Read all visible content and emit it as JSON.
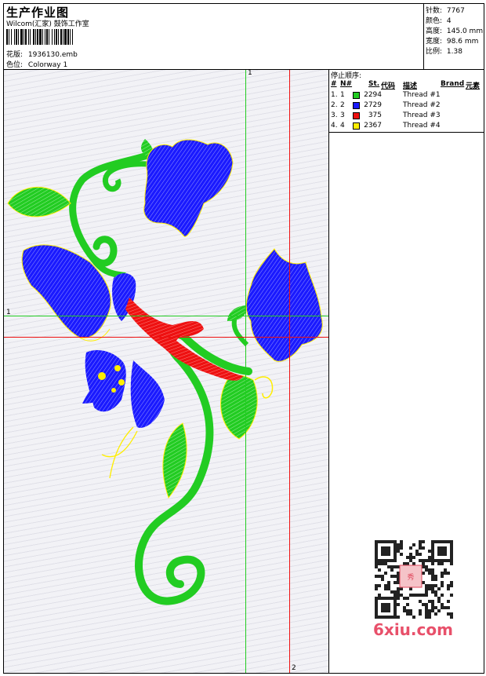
{
  "header": {
    "title": "生产作业图",
    "company": "Wilcom(汇家) 鼓饰工作室",
    "design_label": "花版:",
    "design_value": "1936130.emb",
    "colorway_label": "色位:",
    "colorway_value": "Colorway 1"
  },
  "stats": {
    "stitches_label": "针数:",
    "stitches_value": "7767",
    "colors_label": "颜色:",
    "colors_value": "4",
    "height_label": "高度:",
    "height_value": "145.0 mm",
    "width_label": "宽度:",
    "width_value": "98.6 mm",
    "scale_label": "比例:",
    "scale_value": "1.38"
  },
  "stop_sequence": {
    "title": "停止顺序:",
    "columns": [
      "#",
      "N#",
      "St.",
      "代码",
      "描述",
      "Brand",
      "元素"
    ],
    "rows": [
      {
        "num": "1.",
        "n": "1",
        "code": "2294",
        "desc": "Thread #1",
        "color": "#22cc22"
      },
      {
        "num": "2.",
        "n": "2",
        "code": "2729",
        "desc": "Thread #2",
        "color": "#1a1aff"
      },
      {
        "num": "3.",
        "n": "3",
        "code": "375",
        "desc": "Thread #3",
        "color": "#ee1111"
      },
      {
        "num": "4.",
        "n": "4",
        "code": "2367",
        "desc": "Thread #4",
        "color": "#ffee00"
      }
    ]
  },
  "canvas": {
    "marker_1_top": "1",
    "marker_1_left": "1",
    "marker_2_bottom": "2"
  },
  "watermark": {
    "site": "6xiu.com"
  },
  "colors": {
    "green": "#22cc22",
    "blue": "#1a1aff",
    "red": "#ee1111",
    "yellow": "#ffee00"
  }
}
